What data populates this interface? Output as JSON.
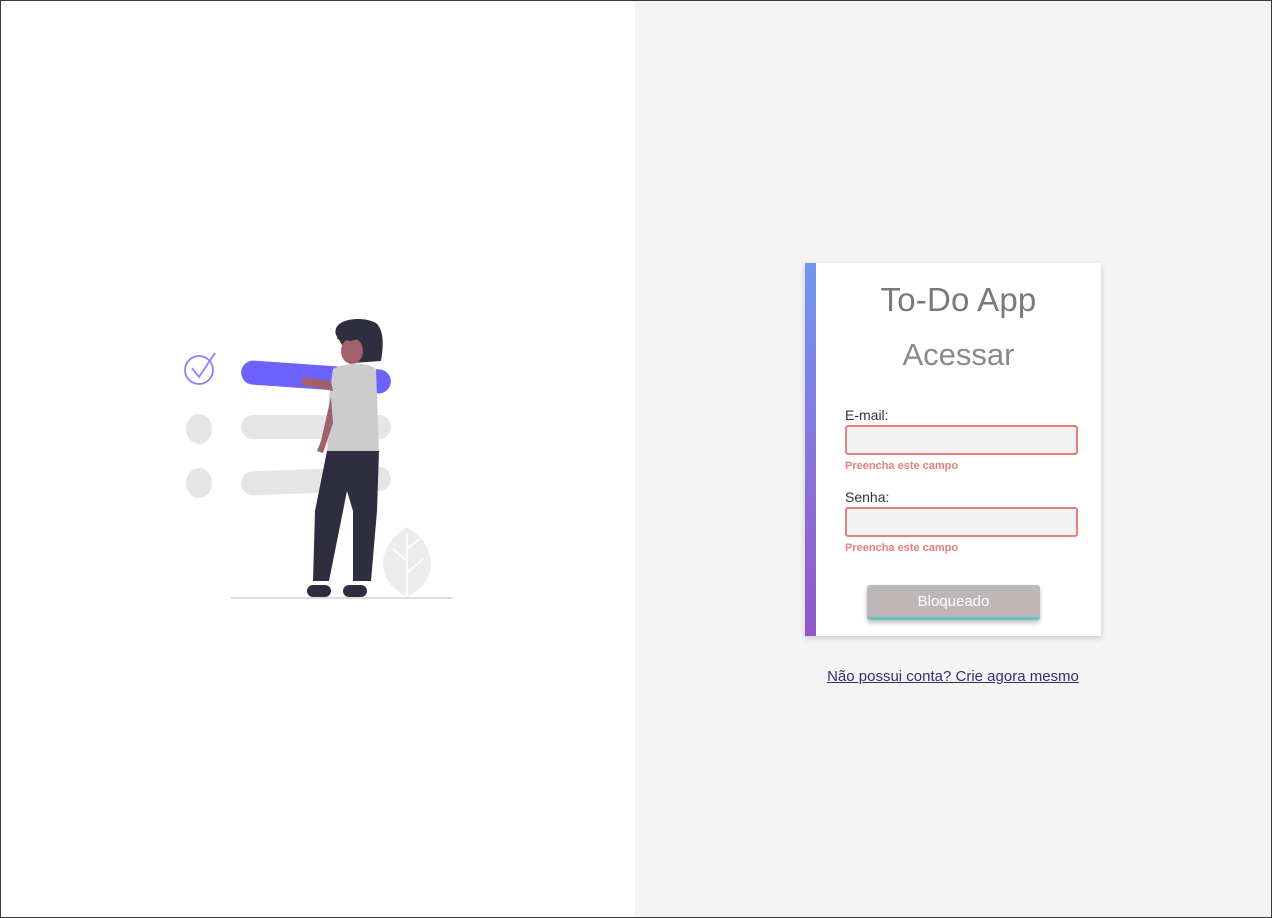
{
  "app": {
    "title": "To-Do App"
  },
  "login": {
    "heading": "Acessar",
    "email": {
      "label": "E-mail:",
      "value": "",
      "placeholder": "",
      "error": "Preencha este campo"
    },
    "password": {
      "label": "Senha:",
      "value": "",
      "placeholder": "",
      "error": "Preencha este campo"
    },
    "submit_label": "Bloqueado",
    "signup_link": "Não possui conta? Crie agora mesmo"
  },
  "colors": {
    "accent_top": "#7196f0",
    "accent_bottom": "#9057c9",
    "error": "#e57f7a",
    "button_disabled": "#bdb7b7",
    "illustration_primary": "#6c63ff"
  },
  "illustration": {
    "icon": "checklist-person-illustration"
  }
}
